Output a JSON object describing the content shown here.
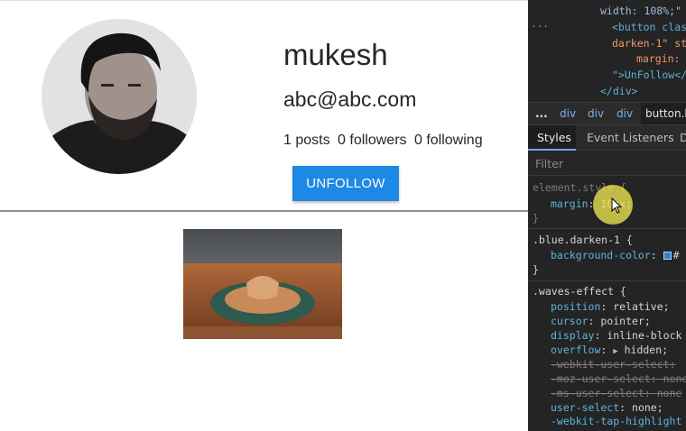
{
  "profile": {
    "username": "mukesh",
    "email": "abc@abc.com",
    "posts_label": "1 posts",
    "followers_label": "0 followers",
    "following_label": "0 following",
    "unfollow_label": "UNFOLLOW"
  },
  "devtools": {
    "elements_lines": [
      "width: 108%;\"",
      "<button clas",
      "darken-1\" st",
      "margin: ",
      "\">UnFollow</",
      "</div>"
    ],
    "gutter": "···",
    "breadcrumb": {
      "ellipsis": "...",
      "items": [
        "div",
        "div",
        "div"
      ],
      "active": "button.b"
    },
    "tabs": [
      "Styles",
      "Event Listeners",
      "D"
    ],
    "filter_placeholder": "Filter",
    "rules": {
      "element_style": {
        "selector": "element.style {",
        "prop": "margin",
        "value": "10px",
        "close": "}"
      },
      "blue_darken": {
        "selector": ".blue.darken-1 {",
        "prop": "background-color",
        "value": "#",
        "close": "}"
      },
      "waves": {
        "selector": ".waves-effect {",
        "lines": [
          {
            "prop": "position",
            "value": "relative;",
            "struck": false
          },
          {
            "prop": "cursor",
            "value": "pointer;",
            "struck": false
          },
          {
            "prop": "display",
            "value": "inline-block",
            "struck": false
          },
          {
            "prop": "overflow",
            "value": "hidden;",
            "struck": false,
            "expander": true
          },
          {
            "prop": "-webkit-user-select",
            "value": "",
            "struck": true
          },
          {
            "prop": "-moz-user-select",
            "value": "none",
            "struck": true
          },
          {
            "prop": "-ms-user-select",
            "value": "none",
            "struck": true
          },
          {
            "prop": "user-select",
            "value": "none;",
            "struck": false
          },
          {
            "prop": "-webkit-tap-highlight",
            "value": "",
            "struck": false
          }
        ]
      }
    }
  },
  "colors": {
    "accent_button": "#1e88e5",
    "devtools_bg": "#242424",
    "cursor_highlight": "#eee450"
  }
}
